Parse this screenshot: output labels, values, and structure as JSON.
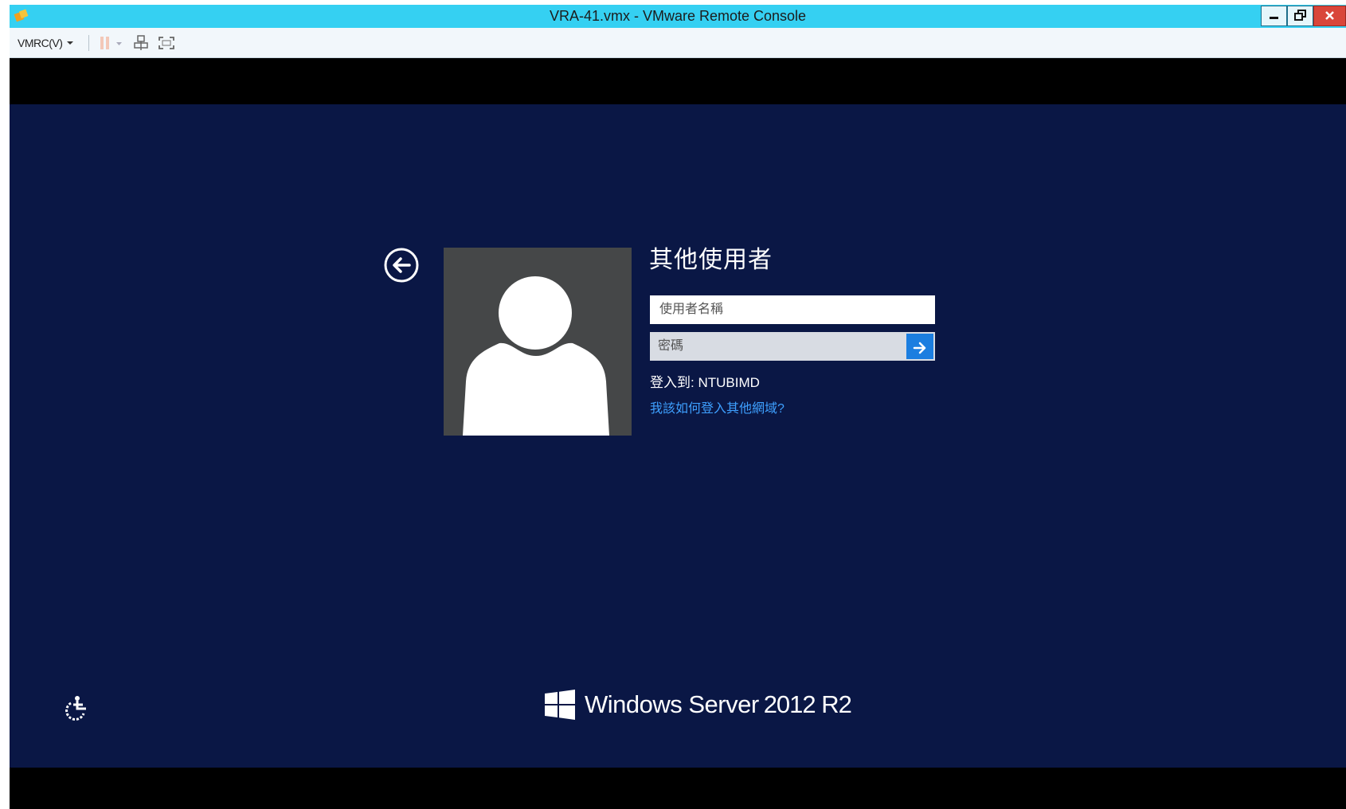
{
  "window": {
    "title": "VRA-41.vmx - VMware Remote Console"
  },
  "toolbar": {
    "menu_label": "VMRC(V)",
    "icons": [
      "pause-icon",
      "dropdown-arrow-icon",
      "send-keys-icon",
      "fullscreen-icon"
    ]
  },
  "login": {
    "heading": "其他使用者",
    "username_placeholder": "使用者名稱",
    "password_placeholder": "密碼",
    "signin_to": "登入到: NTUBIMD",
    "other_domain_link": "我該如何登入其他網域?"
  },
  "branding": {
    "os_name": "Windows Server",
    "os_version": "2012 R2"
  },
  "colors": {
    "titlebar": "#35d0f2",
    "screen_background": "#0a1745",
    "avatar_background": "#454748",
    "submit_button": "#1b7ee0",
    "link": "#3ea0ff"
  }
}
